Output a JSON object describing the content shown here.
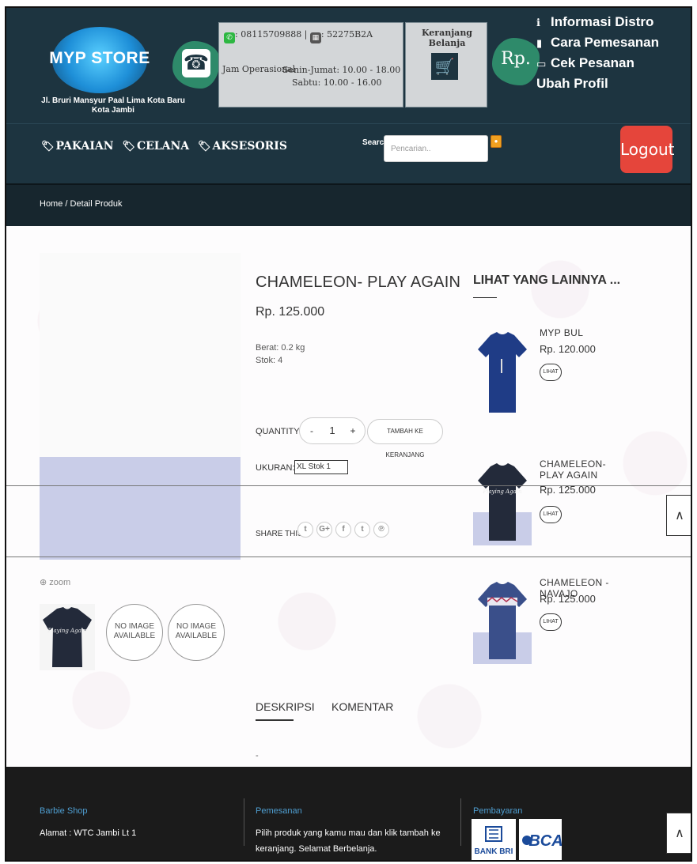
{
  "header": {
    "logo_text": "MYP STORE",
    "address": "Jl. Bruri Mansyur Paal Lima Kota Baru Kota Jambi",
    "whatsapp": ": 08115709888 |",
    "bbm": ": 52275B2A",
    "hours_label": "Jam Operasional",
    "hours_weekday": "Senin-Jumat: 10.00 - 18.00",
    "hours_saturday": "Sabtu: 10.00 - 16.00",
    "cart_title": "Keranjang Belanja",
    "rp_label": "Rp.",
    "links": [
      "Informasi Distro",
      "Cara Pemesanan",
      "Cek Pesanan",
      "Ubah Profil"
    ]
  },
  "nav": {
    "categories": [
      "PAKAIAN",
      "CELANA",
      "AKSESORIS"
    ],
    "search_label": "Search",
    "search_placeholder": "Pencarian..",
    "logout_label": "Logout"
  },
  "breadcrumb": "Home  /  Detail Produk",
  "product": {
    "title": "CHAMELEON- PLAY AGAIN",
    "price": "Rp. 125.000",
    "weight": "Berat: 0.2 kg",
    "stock": "Stok: 4",
    "quantity_label": "QUANTITY:",
    "quantity_value": "1",
    "minus_label": "-",
    "plus_label": "+",
    "add_to_cart_label": "TAMBAH KE KERANJANG",
    "size_label": "UKURAN:",
    "size_selected": "XL Stok 1",
    "share_label": "SHARE THIS:",
    "share_icons": [
      "twitter-icon",
      "google-plus-icon",
      "facebook-icon",
      "tumblr-icon",
      "pinterest-icon"
    ],
    "zoom_label": "zoom",
    "no_image_label": "NO IMAGE AVAILABLE",
    "tabs": [
      "DESKRIPSI",
      "KOMENTAR"
    ],
    "description": "-"
  },
  "related": {
    "title": "LIHAT YANG LAINNYA ...",
    "items": [
      {
        "name": "MYP BUL",
        "price": "Rp. 120.000",
        "button": "LIHAT"
      },
      {
        "name": "CHAMELEON- PLAY AGAIN",
        "price": "Rp. 125.000",
        "button": "LIHAT"
      },
      {
        "name": "CHAMELEON - NAVAJO",
        "price": "Rp. 125.000",
        "button": "LIHAT"
      }
    ]
  },
  "footer": {
    "col1_head": "Barbie Shop",
    "col1_text": "Alamat : WTC Jambi Lt 1",
    "col2_head": "Pemesanan",
    "col2_text": "Pilih produk yang kamu mau dan klik tambah ke keranjang. Selamat Berbelanja.",
    "col3_head": "Pembayaran",
    "bank1": "BANK BRI",
    "bank2": "BCA"
  },
  "colors": {
    "header_bg": "#1d3440",
    "logout": "#e5453b",
    "footer_bg": "#1b1b1b",
    "footer_head": "#4f9fd2"
  }
}
